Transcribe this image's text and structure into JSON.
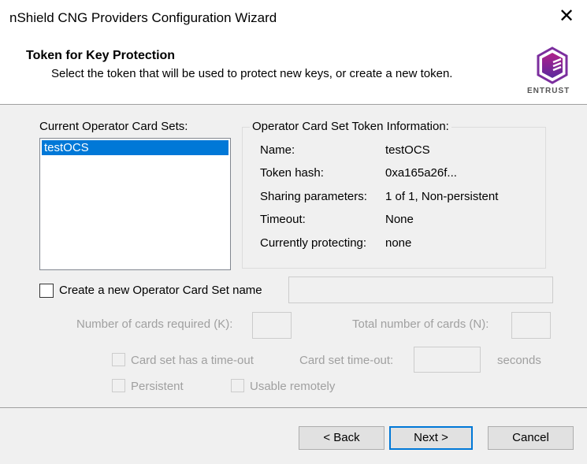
{
  "window": {
    "title": "nShield CNG Providers Configuration Wizard"
  },
  "header": {
    "title": "Token for Key Protection",
    "subtitle": "Select the token that will be used to protect new keys, or create a new token.",
    "logo_text": "ENTRUST",
    "brand_color": "#7b2e9e"
  },
  "card_sets": {
    "label": "Current Operator Card Sets:",
    "items": [
      "testOCS"
    ],
    "selected": "testOCS"
  },
  "token_info": {
    "label": "Operator Card Set Token Information:",
    "rows": [
      {
        "key": "Name:",
        "value": "testOCS"
      },
      {
        "key": "Token hash:",
        "value": "0xa165a26f..."
      },
      {
        "key": "Sharing parameters:",
        "value": "1 of 1, Non-persistent"
      },
      {
        "key": "Timeout:",
        "value": "None"
      },
      {
        "key": "Currently protecting:",
        "value": "none"
      }
    ]
  },
  "create": {
    "label": "Create a new Operator Card Set name",
    "checked": false,
    "name_value": "",
    "k_label": "Number of cards required (K):",
    "k_value": "",
    "n_label": "Total number of cards (N):",
    "n_value": "",
    "timeout_check": "Card set has a time-out",
    "timeout_label": "Card set time-out:",
    "timeout_value": "",
    "seconds": "seconds",
    "persistent": "Persistent",
    "remote": "Usable remotely"
  },
  "buttons": {
    "back": "< Back",
    "next": "Next >",
    "cancel": "Cancel"
  }
}
